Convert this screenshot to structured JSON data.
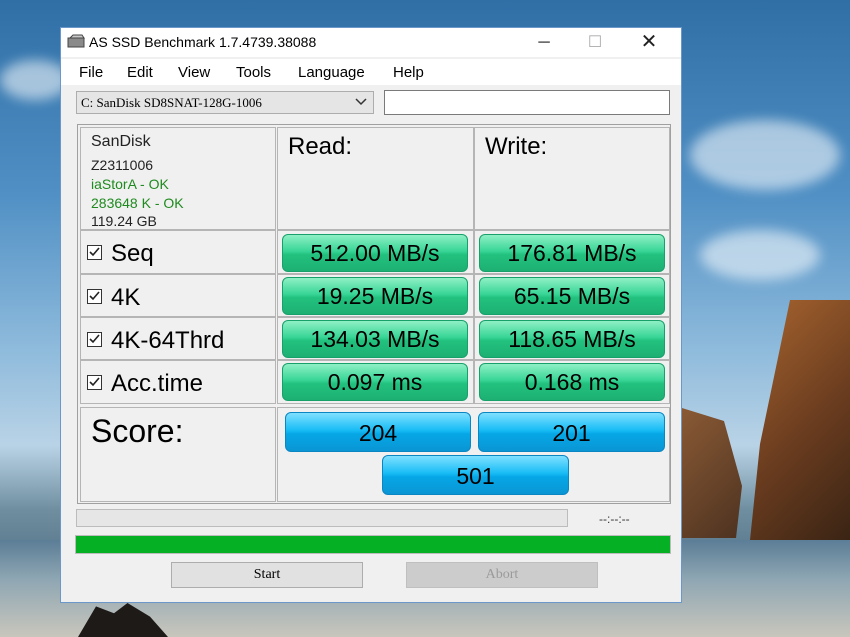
{
  "window": {
    "title": "AS SSD Benchmark 1.7.4739.38088",
    "minimize_glyph": "─",
    "maximize_glyph": "☐",
    "close_glyph": "✕"
  },
  "menu": [
    "File",
    "Edit",
    "View",
    "Tools",
    "Language",
    "Help"
  ],
  "drive": {
    "selected": "C: SanDisk SD8SNAT-128G-1006",
    "path_value": ""
  },
  "info": {
    "vendor": "SanDisk",
    "firmware": "Z2311006",
    "driver_status": "iaStorA - OK",
    "alignment_status": "283648 K - OK",
    "capacity": "119.24 GB"
  },
  "headers": {
    "read": "Read:",
    "write": "Write:"
  },
  "tests": [
    {
      "label": "Seq",
      "checked": true,
      "read": "512.00 MB/s",
      "write": "176.81 MB/s"
    },
    {
      "label": "4K",
      "checked": true,
      "read": "19.25 MB/s",
      "write": "65.15 MB/s"
    },
    {
      "label": "4K-64Thrd",
      "checked": true,
      "read": "134.03 MB/s",
      "write": "118.65 MB/s"
    },
    {
      "label": "Acc.time",
      "checked": true,
      "read": "0.097 ms",
      "write": "0.168 ms"
    }
  ],
  "score": {
    "label": "Score:",
    "read": "204",
    "write": "201",
    "total": "501"
  },
  "progress": {
    "time": "--:--:--",
    "main_fraction": 1.0
  },
  "buttons": {
    "start": "Start",
    "abort": "Abort"
  },
  "colors": {
    "result_green": "#22c17e",
    "score_blue": "#06a7e6",
    "ok_text": "#1f8a1f",
    "progress_green": "#06b025"
  }
}
